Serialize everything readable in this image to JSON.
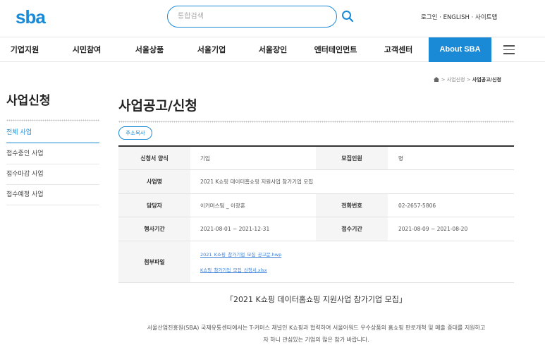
{
  "header": {
    "logo": "sba",
    "search_placeholder": "통합검색",
    "top_links": [
      "로그인",
      "ENGLISH",
      "사이트맵"
    ],
    "separator": " · "
  },
  "gnb": {
    "items": [
      "기업지원",
      "시민참여",
      "서울상품",
      "서울기업",
      "서울장인",
      "엔터테인먼트",
      "고객센터"
    ],
    "about": "About SBA"
  },
  "breadcrumb": {
    "parts": [
      "사업신청"
    ],
    "current": "사업공고/신청",
    "separator": " > "
  },
  "sidebar": {
    "title": "사업신청",
    "items": [
      "전체 사업",
      "접수중인 사업",
      "접수마감 사업",
      "접수예정 사업"
    ],
    "active_index": 0
  },
  "main": {
    "title": "사업공고/신청",
    "copy_button": "주소복사",
    "table": {
      "r1": {
        "k1": "신청서 양식",
        "v1": "기업",
        "k2": "모집인원",
        "v2": "명"
      },
      "r2": {
        "k1": "사업명",
        "v1": "2021 K쇼핑 데이터홈쇼핑 지원사업 참가기업 모집"
      },
      "r3": {
        "k1": "담당자",
        "v1": "이커머스팀 _ 이광훈",
        "k2": "전화번호",
        "v2": "02-2657-5806"
      },
      "r4": {
        "k1": "행사기간",
        "v1": "2021-08-01 ~ 2021-12-31",
        "k2": "접수기간",
        "v2": "2021-08-09 ~ 2021-08-20"
      },
      "r5": {
        "k1": "첨부파일",
        "files": [
          "2021_K쇼핑_참가기업_모집_공고문.hwp",
          "K쇼핑_참가기업_모집_신청서.xlsx"
        ]
      }
    },
    "content_title": "「2021 K쇼핑 데이터홈쇼핑 지원사업 참가기업 모집」",
    "content_body_1": "서울산업진흥원(SBA) 국제유통센터에서는 T-커머스 채널인 K쇼핑과 협력하여 서울어워드 우수상품의 홈쇼핑 판로개척 및 매출 증대를 지원하고",
    "content_body_2": "자 하니 관심있는 기업의 많은 참가 바랍니다."
  },
  "colors": {
    "accent": "#1a8ad6"
  }
}
